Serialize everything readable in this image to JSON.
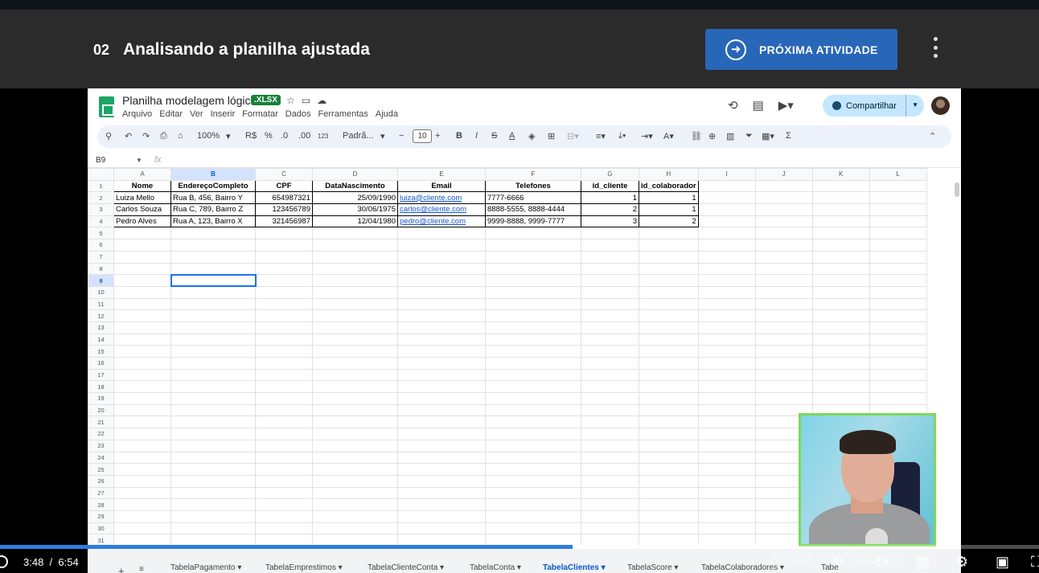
{
  "header": {
    "lesson_number": "02",
    "lesson_title": "Analisando a planilha ajustada",
    "next_button_label": "PRÓXIMA ATIVIDADE"
  },
  "spreadsheet": {
    "file_title": "Planilha modelagem lógica",
    "file_badge": ".XLSX",
    "menu": [
      "Arquivo",
      "Editar",
      "Ver",
      "Inserir",
      "Formatar",
      "Dados",
      "Ferramentas",
      "Ajuda"
    ],
    "share_label": "Compartilhar",
    "toolbar": {
      "zoom": "100%",
      "currency": "R$",
      "percent": "%",
      "dec_less": ".0",
      "dec_more": ".00",
      "num_format": "123",
      "font": "Padrã...",
      "font_size": "10"
    },
    "name_box": "B9",
    "fx_label": "fx",
    "columns": [
      "A",
      "B",
      "C",
      "D",
      "E",
      "F",
      "G",
      "H",
      "I",
      "J",
      "K",
      "L"
    ],
    "selected_column": "B",
    "selected_row": 9,
    "header_row": [
      "Nome",
      "EndereçoCompleto",
      "CPF",
      "DataNascimento",
      "Email",
      "Telefones",
      "id_cliente",
      "id_colaborador"
    ],
    "rows": [
      [
        "Luiza Mello",
        "Rua B, 456, Bairro Y",
        "654987321",
        "25/09/1990",
        "luiza@cliente.com",
        "7777-6666",
        "1",
        "1"
      ],
      [
        "Carlos Souza",
        "Rua C, 789, Bairro Z",
        "123456789",
        "30/06/1975",
        "carlos@cliente.com",
        "8888-5555, 8888-4444",
        "2",
        "1"
      ],
      [
        "Pedro Alves",
        "Rua A, 123, Bairro X",
        "321456987",
        "12/04/1980",
        "pedro@cliente.com",
        "9999-8888, 9999-7777",
        "3",
        "2"
      ]
    ],
    "row_numbers": [
      "1",
      "2",
      "3",
      "4",
      "5",
      "6",
      "7",
      "8",
      "9",
      "10",
      "11",
      "12",
      "13",
      "14",
      "15",
      "16",
      "17",
      "18",
      "19",
      "20",
      "21",
      "22",
      "23",
      "24",
      "25",
      "26",
      "27",
      "28",
      "29",
      "30",
      "31"
    ],
    "sheet_tabs": [
      "TabelaPagamento",
      "TabelaEmprestimos",
      "TabelaClienteConta",
      "TabelaConta",
      "TabelaClientes",
      "TabelaScore",
      "TabelaColaboradores",
      "Tabe"
    ],
    "active_tab": "TabelaClientes"
  },
  "player": {
    "current_time": "3:48",
    "separator": "/",
    "duration": "6:54",
    "progress_fraction": 0.551,
    "speed": "1x",
    "watermark": "Ativar o Windows"
  },
  "colors": {
    "accent": "#2866b8",
    "progress": "#2f7de1",
    "webcam_border": "#7ed957"
  }
}
